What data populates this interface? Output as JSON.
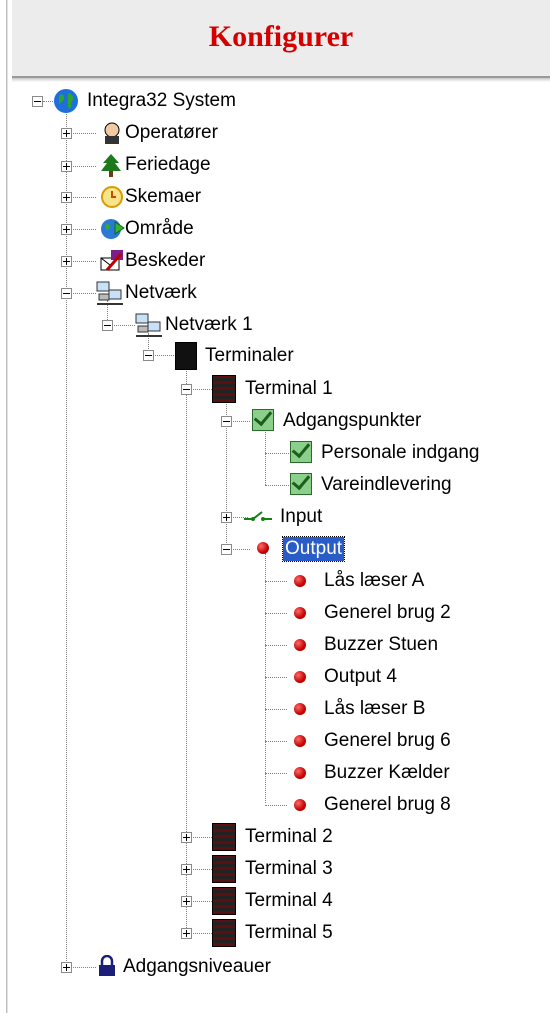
{
  "header": {
    "title": "Konfigurer"
  },
  "colors": {
    "title_red": "#d40000",
    "selection_blue": "#2a5cc8"
  },
  "tree": {
    "root": "Integra32 System",
    "operators": "Operatører",
    "holidays": "Feriedage",
    "schedules": "Skemaer",
    "area": "Område",
    "messages": "Beskeder",
    "network": "Netværk",
    "network1": "Netværk 1",
    "terminals": "Terminaler",
    "terminal1": "Terminal 1",
    "accesspoints": "Adgangspunkter",
    "ap1": "Personale indgang",
    "ap2": "Vareindlevering",
    "input": "Input",
    "output": "Output",
    "outputs": [
      "Lås læser A",
      "Generel brug 2",
      "Buzzer Stuen",
      "Output 4",
      "Lås læser B",
      "Generel brug 6",
      "Buzzer Kælder",
      "Generel brug 8"
    ],
    "terminal2": "Terminal 2",
    "terminal3": "Terminal 3",
    "terminal4": "Terminal 4",
    "terminal5": "Terminal 5",
    "accesslevels": "Adgangsniveauer"
  }
}
